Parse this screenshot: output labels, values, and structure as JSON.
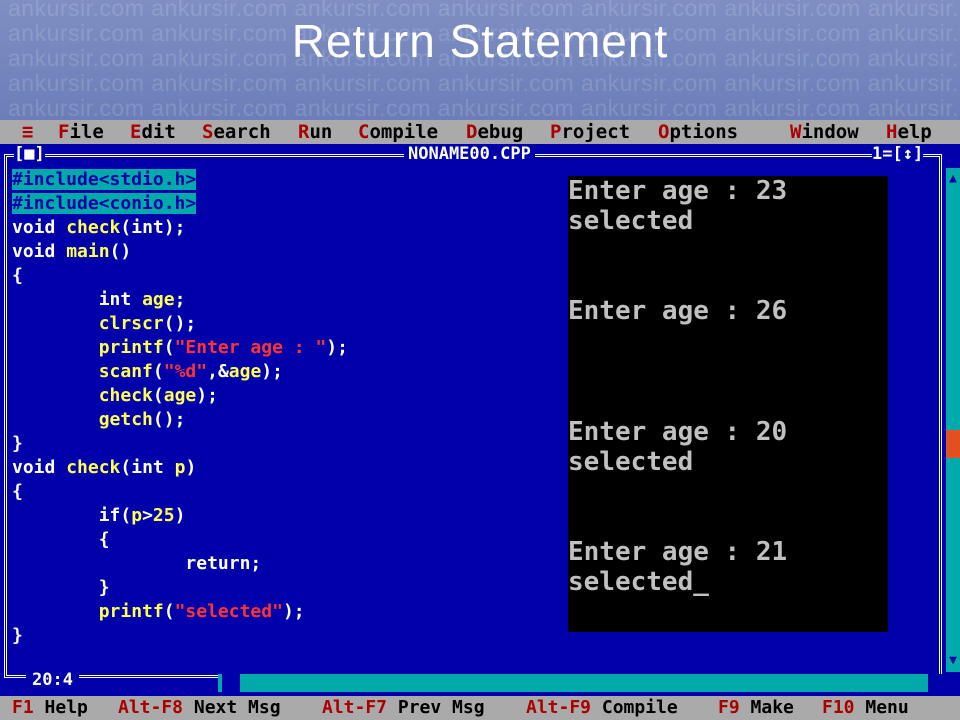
{
  "title": "Return Statement",
  "watermark": "ankursir.com",
  "menu": [
    {
      "key": "≡",
      "label": ""
    },
    {
      "key": "F",
      "label": "ile"
    },
    {
      "key": "E",
      "label": "dit"
    },
    {
      "key": "S",
      "label": "earch"
    },
    {
      "key": "R",
      "label": "un"
    },
    {
      "key": "C",
      "label": "ompile"
    },
    {
      "key": "D",
      "label": "ebug"
    },
    {
      "key": "P",
      "label": "roject"
    },
    {
      "key": "O",
      "label": "ptions"
    },
    {
      "key": "W",
      "label": "indow"
    },
    {
      "key": "H",
      "label": "elp"
    }
  ],
  "editor": {
    "close_box": "[■]",
    "file_name": "NONAME00.CPP",
    "window_number": "1=[↕]",
    "cursor_position": "20:4"
  },
  "code": [
    "#include<stdio.h>",
    "#include<conio.h>",
    "void check(int);",
    "void main()",
    "{",
    "        int age;",
    "        clrscr();",
    "        printf(\"Enter age : \");",
    "        scanf(\"%d\",&age);",
    "        check(age);",
    "        getch();",
    "}",
    "void check(int p)",
    "{",
    "        if(p>25)",
    "        {",
    "                return;",
    "        }",
    "        printf(\"selected\");",
    "}"
  ],
  "output": [
    {
      "prompt": "Enter age : 23",
      "result": "selected"
    },
    {
      "prompt": "Enter age : 26",
      "result": ""
    },
    {
      "prompt": "Enter age : 20",
      "result": "selected"
    },
    {
      "prompt": "Enter age : 21",
      "result": "selected_"
    }
  ],
  "status": [
    {
      "key": "F1",
      "label": "Help"
    },
    {
      "key": "Alt-F8",
      "label": "Next Msg"
    },
    {
      "key": "Alt-F7",
      "label": "Prev Msg"
    },
    {
      "key": "Alt-F9",
      "label": "Compile"
    },
    {
      "key": "F9",
      "label": "Make"
    },
    {
      "key": "F10",
      "label": "Menu"
    }
  ],
  "colors": {
    "editor_bg": "#0000aa",
    "menu_bg": "#aaaaaa",
    "hotkey": "#aa0000",
    "identifier": "#ffff55",
    "string": "#ff3333",
    "output_bg": "#000000"
  }
}
